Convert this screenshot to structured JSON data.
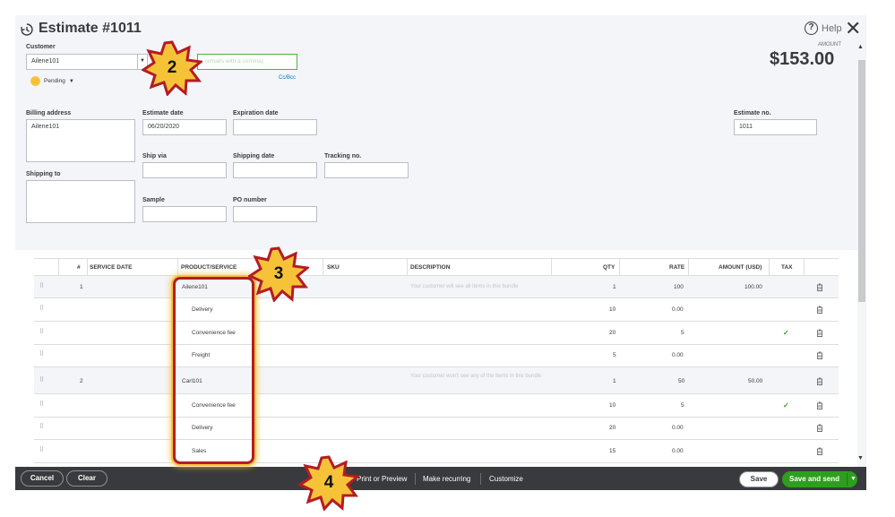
{
  "header": {
    "title": "Estimate #1011",
    "help_label": "Help",
    "close_glyph": "✕"
  },
  "customer": {
    "label": "Customer",
    "value": "Ailene101",
    "status": "Pending",
    "email_placeholder": "(emails with a comma)",
    "cc_bcc": "Cc/Bcc"
  },
  "amount": {
    "label": "AMOUNT",
    "value": "$153.00"
  },
  "form": {
    "billing_address_label": "Billing address",
    "billing_address_value": "Ailene101",
    "shipping_to_label": "Shipping to",
    "estimate_date_label": "Estimate date",
    "estimate_date_value": "06/20/2020",
    "expiration_date_label": "Expiration date",
    "ship_via_label": "Ship via",
    "shipping_date_label": "Shipping date",
    "tracking_no_label": "Tracking no.",
    "sample_label": "Sample",
    "po_number_label": "PO number",
    "estimate_no_label": "Estimate no.",
    "estimate_no_value": "1011"
  },
  "table": {
    "columns": [
      "#",
      "SERVICE DATE",
      "PRODUCT/SERVICE",
      "SKU",
      "DESCRIPTION",
      "QTY",
      "RATE",
      "AMOUNT (USD)",
      "TAX"
    ],
    "rows": [
      {
        "num": "1",
        "product": "Ailene101",
        "description": "Your customer will see all items in this bundle",
        "qty": "1",
        "rate": "100",
        "amount": "100.00",
        "tax": ""
      },
      {
        "num": "",
        "product": "Delivery",
        "description": "",
        "qty": "10",
        "rate": "0.00",
        "amount": "",
        "tax": ""
      },
      {
        "num": "",
        "product": "Convenience fee",
        "description": "",
        "qty": "20",
        "rate": "5",
        "amount": "",
        "tax": "✓"
      },
      {
        "num": "",
        "product": "Freight",
        "description": "",
        "qty": "5",
        "rate": "0.00",
        "amount": "",
        "tax": ""
      },
      {
        "num": "2",
        "product": "Carl101",
        "description": "Your customer won't see any of the items in this bundle",
        "qty": "1",
        "rate": "50",
        "amount": "50.00",
        "tax": ""
      },
      {
        "num": "",
        "product": "Convenience fee",
        "description": "",
        "qty": "10",
        "rate": "5",
        "amount": "",
        "tax": "✓"
      },
      {
        "num": "",
        "product": "Delivery",
        "description": "",
        "qty": "20",
        "rate": "0.00",
        "amount": "",
        "tax": ""
      },
      {
        "num": "",
        "product": "Sales",
        "description": "",
        "qty": "15",
        "rate": "0.00",
        "amount": "",
        "tax": ""
      }
    ]
  },
  "footer": {
    "cancel": "Cancel",
    "clear": "Clear",
    "print_preview": "Print or Preview",
    "make_recurring": "Make recurring",
    "customize": "Customize",
    "save": "Save",
    "save_send": "Save and send"
  },
  "callouts": {
    "c2": "2",
    "c3": "3",
    "c4": "4"
  },
  "colors": {
    "accent_green": "#2ca01c",
    "callout_fill": "#f6c338",
    "callout_border": "#b31c24",
    "footer_bg": "#393a3d"
  }
}
